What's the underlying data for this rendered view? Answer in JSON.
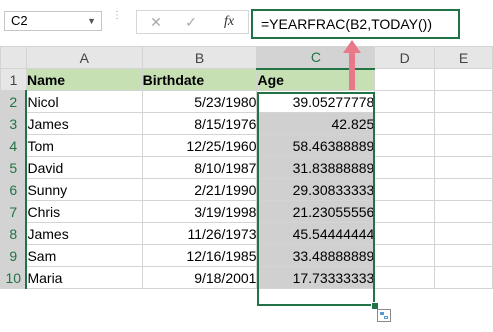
{
  "formula_bar": {
    "name_box": "C2",
    "cancel_icon": "✕",
    "enter_icon": "✓",
    "fx_label": "fx",
    "formula": "=YEARFRAC(B2,TODAY())"
  },
  "columns": [
    "A",
    "B",
    "C",
    "D",
    "E"
  ],
  "rows": [
    "1",
    "2",
    "3",
    "4",
    "5",
    "6",
    "7",
    "8",
    "9",
    "10"
  ],
  "headers": {
    "name": "Name",
    "birthdate": "Birthdate",
    "age": "Age"
  },
  "data": [
    {
      "name": "Nicol",
      "birthdate": "5/23/1980",
      "age": "39.05277778"
    },
    {
      "name": "James",
      "birthdate": "8/15/1976",
      "age": "42.825"
    },
    {
      "name": "Tom",
      "birthdate": "12/25/1960",
      "age": "58.46388889"
    },
    {
      "name": "David",
      "birthdate": "8/10/1987",
      "age": "31.83888889"
    },
    {
      "name": "Sunny",
      "birthdate": "2/21/1990",
      "age": "29.30833333"
    },
    {
      "name": "Chris",
      "birthdate": "3/19/1998",
      "age": "21.23055556"
    },
    {
      "name": "James",
      "birthdate": "11/26/1973",
      "age": "45.54444444"
    },
    {
      "name": "Sam",
      "birthdate": "12/16/1985",
      "age": "33.48888889"
    },
    {
      "name": "Maria",
      "birthdate": "9/18/2001",
      "age": "17.73333333"
    }
  ],
  "colors": {
    "accent": "#217346",
    "header_fill": "#c6e0b4",
    "arrow": "#e8788a",
    "selection_fill": "#d0d0d0"
  },
  "icons": {
    "arrow": "arrow-up-icon",
    "quick_analysis": "quick-analysis-icon"
  }
}
